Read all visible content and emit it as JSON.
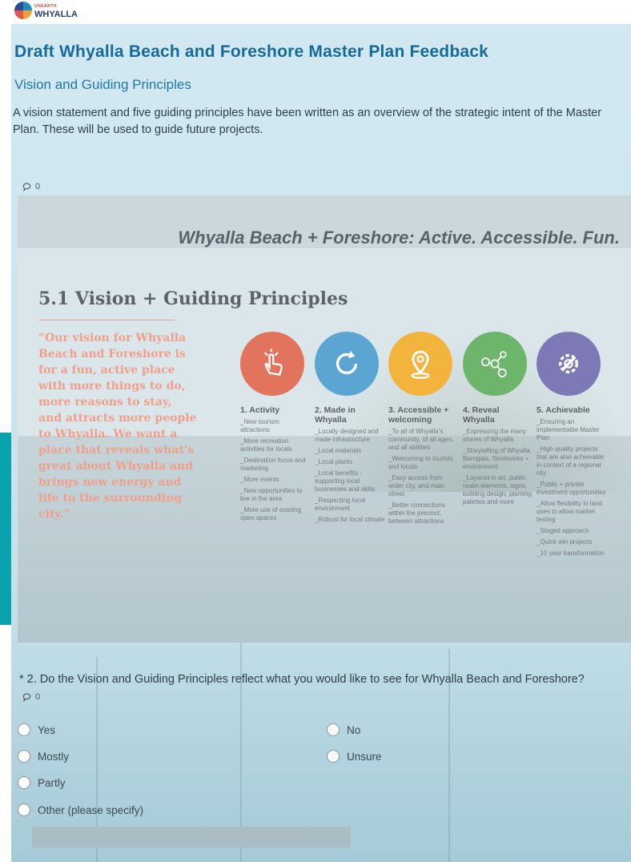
{
  "header": {
    "logo_small": "UNEARTH",
    "logo_text": "WHYALLA"
  },
  "page": {
    "title": "Draft Whyalla Beach and Foreshore Master Plan Feedback",
    "section_title": "Vision and Guiding Principles",
    "intro": "A vision statement and five guiding principles have been written as an overview of the strategic intent of the Master Plan. These will be used to guide future projects.",
    "comment_count_1": "0"
  },
  "slide": {
    "tagline": "Whyalla Beach + Foreshore: Active. Accessible. Fun.",
    "heading": "5.1 Vision + Guiding Principles",
    "vision": "“Our vision for Whyalla Beach and Foreshore is for a fun, active place with more things to do, more reasons to stay, and attracts more people to Whyalla. We want a place that reveals what’s great about Whyalla and brings new energy and life to the surrounding city.”",
    "colors": [
      "#e2745e",
      "#5ba5d2",
      "#f2b43d",
      "#6cb56b",
      "#7d79b7"
    ],
    "principles": [
      {
        "title": "1. Activity",
        "icon": "hand-tap-icon",
        "items": [
          "_New tourism attractions",
          "_More recreation activities for locals",
          "_Destination focus and marketing",
          "_More events",
          "_New opportunities to live in the area",
          "_More use of existing open spaces"
        ]
      },
      {
        "title": "2. Made in Whyalla",
        "icon": "refresh-icon",
        "items": [
          "_Locally designed and made infrastructure",
          "_Local materials",
          "_Local plants",
          "_Local benefits - supporting local businesses and skills",
          "_Respecting local environment",
          "_Robust for local climate"
        ]
      },
      {
        "title": "3. Accessible + welcoming",
        "icon": "location-pin-icon",
        "items": [
          "_To all of Whyalla’s community, of all ages, and all abilities",
          "_Welcoming to tourists and locals",
          "_Easy access from wider city, and main street",
          "_Better connections within the precinct, between attractions"
        ]
      },
      {
        "title": "4. Reveal Whyalla",
        "icon": "dots-network-icon",
        "items": [
          "_Expressing the many stories of Whyalla",
          "_Storytelling of Whyalla, Barngala, Steelworks + environment",
          "_Layered in art, public realm elements, signs, building design, planting palettes and more"
        ]
      },
      {
        "title": "5. Achievable",
        "icon": "gear-wrench-icon",
        "items": [
          "_Ensuring an implementable Master Plan",
          "_High quality projects that are also achievable in context of a regional city",
          "_Public + private investment opportunities",
          "_Allow flexibility in land uses to allow market testing",
          "_Staged approach",
          "_Quick win projects",
          "_10 year transformation"
        ]
      }
    ]
  },
  "question": {
    "text": "* 2. Do the Vision and Guiding Principles reflect what you would like to see for Whyalla Beach and Foreshore?",
    "comment_count": "0",
    "options": [
      "Yes",
      "No",
      "Mostly",
      "Unsure",
      "Partly",
      "Other (please specify)"
    ],
    "other_value": ""
  }
}
